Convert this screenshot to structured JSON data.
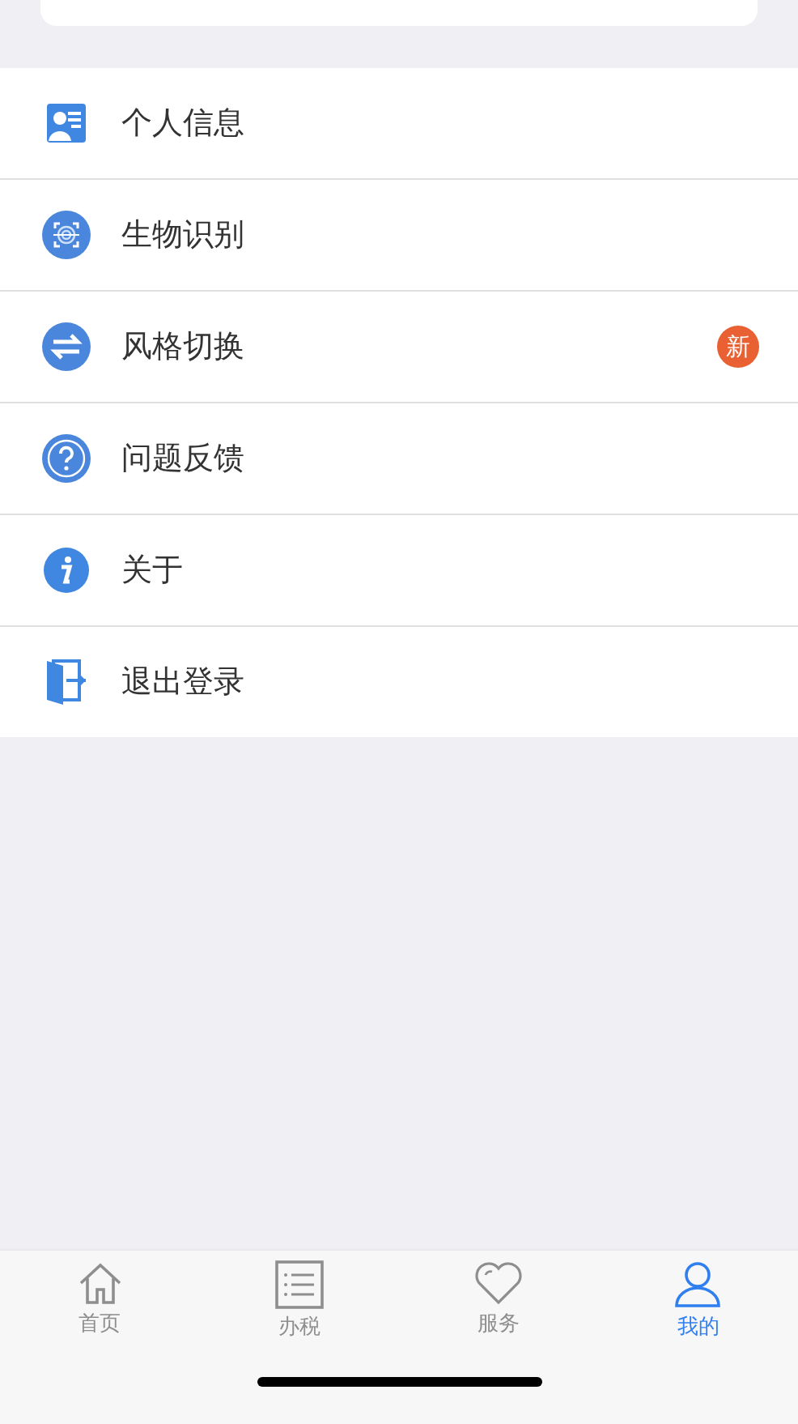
{
  "menu": [
    {
      "kind": "profile",
      "label": "个人信息"
    },
    {
      "kind": "biometric",
      "label": "生物识别"
    },
    {
      "kind": "switch",
      "label": "风格切换",
      "badge": "新"
    },
    {
      "kind": "help",
      "label": "问题反馈"
    },
    {
      "kind": "info",
      "label": "关于"
    },
    {
      "kind": "logout",
      "label": "退出登录"
    }
  ],
  "tab_bar": [
    {
      "kind": "home",
      "label": "首页",
      "selected": false
    },
    {
      "kind": "list",
      "label": "办税",
      "selected": false
    },
    {
      "kind": "heart",
      "label": "服务",
      "selected": false
    },
    {
      "kind": "user",
      "label": "我的",
      "selected": true
    }
  ]
}
